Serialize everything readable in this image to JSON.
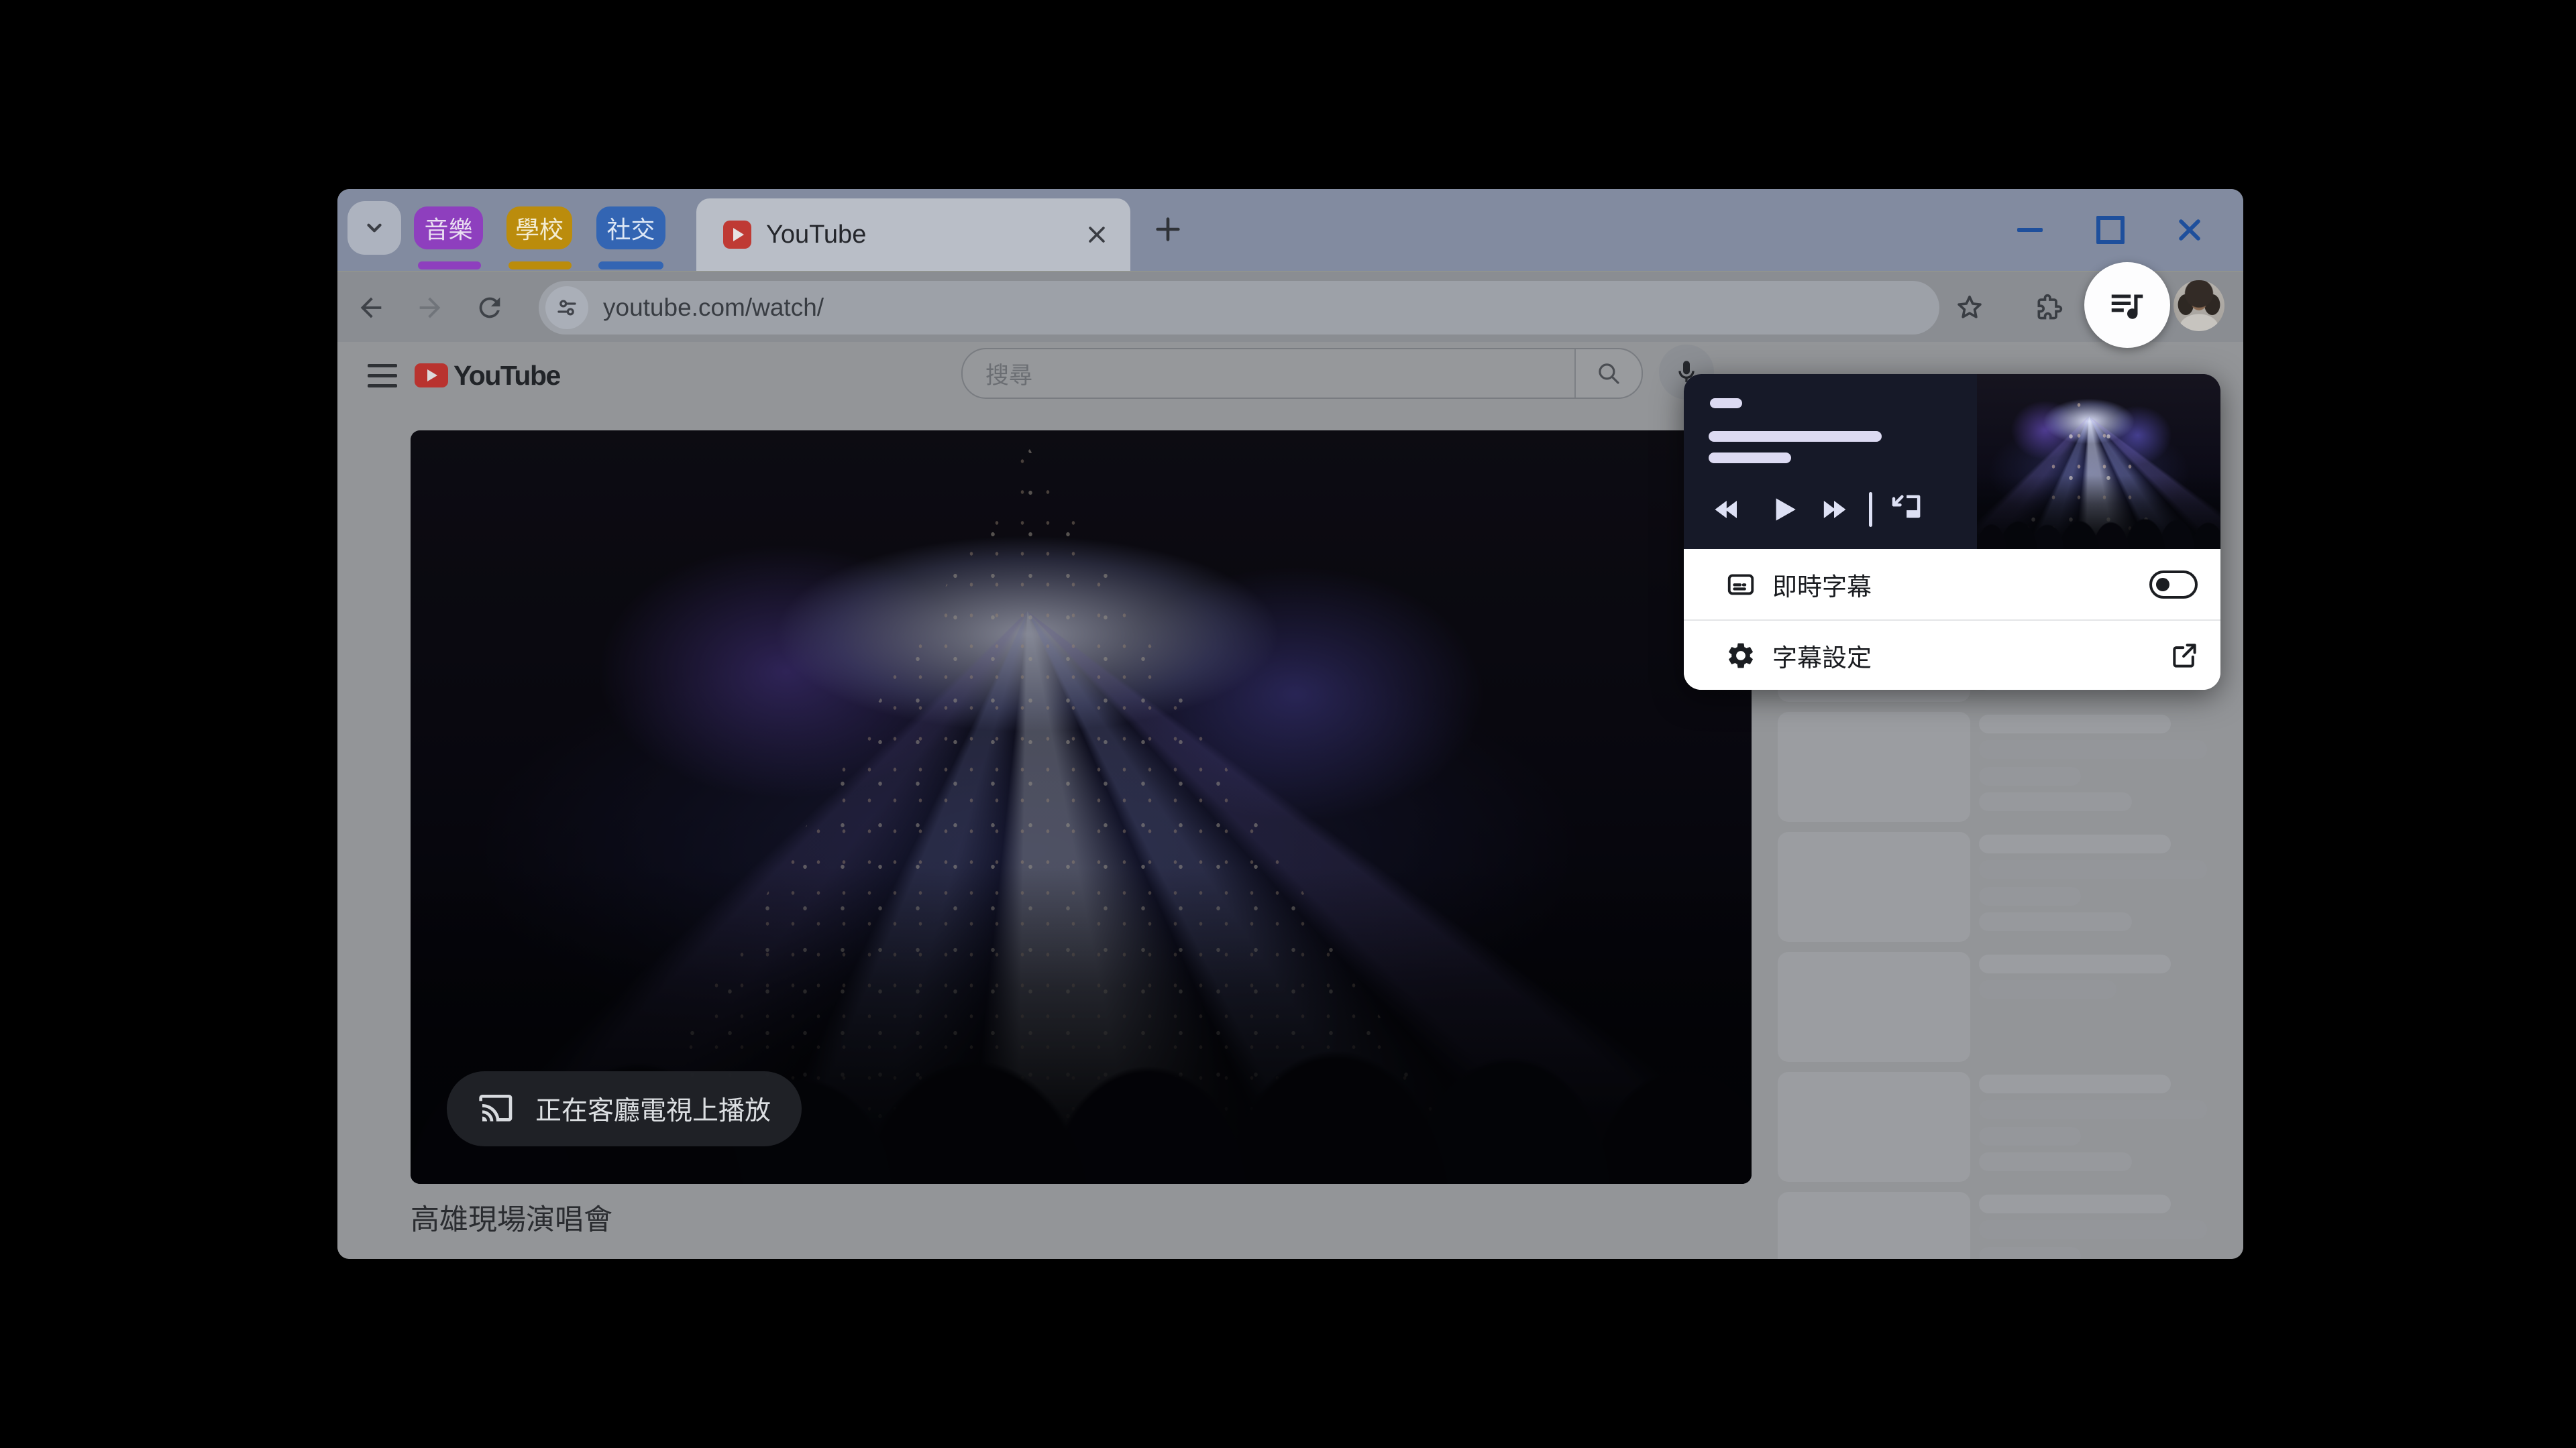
{
  "tab_strip": {
    "groups": [
      {
        "label": "音樂",
        "color": "#8e3fbe"
      },
      {
        "label": "學校",
        "color": "#bb8c0c"
      },
      {
        "label": "社交",
        "color": "#3365b3"
      }
    ],
    "active_tab": {
      "label": "YouTube"
    },
    "new_tab_label": "+"
  },
  "toolbar": {
    "url": "youtube.com/watch/"
  },
  "youtube": {
    "search_placeholder": "搜尋",
    "cast_status": "正在客廳電視上播放",
    "video_title": "高雄現場演唱會"
  },
  "media_popup": {
    "live_caption_label": "即時字幕",
    "live_caption_state": "off",
    "caption_settings_label": "字幕設定"
  },
  "colors": {
    "youtube_red": "#bf3a34",
    "group_purple": "#8e3fbe",
    "group_yellow": "#bb8c0c",
    "group_blue": "#3365b3",
    "window_controls_blue": "#1e4f9c",
    "popup_dark_bg": "#161928",
    "popup_accent": "#dcdaf2"
  }
}
